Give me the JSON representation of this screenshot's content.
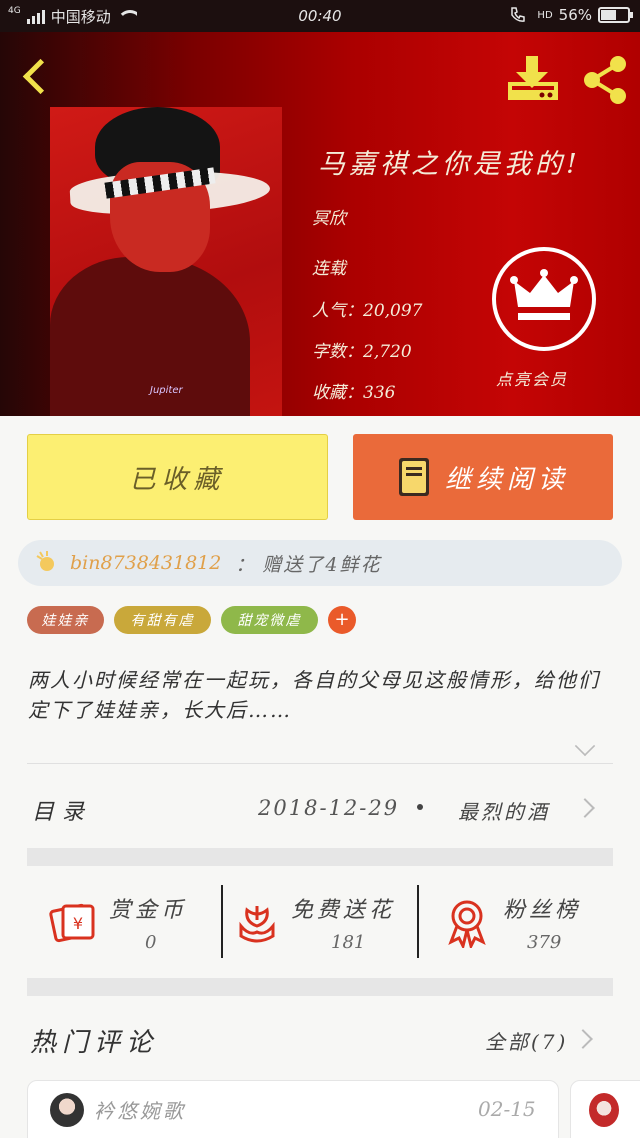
{
  "status_bar": {
    "network": "4G",
    "carrier": "中国移动",
    "time": "00:40",
    "hd": "HD",
    "battery": "56%",
    "battery_level": 0.56
  },
  "header": {
    "title": "马嘉祺之你是我的!",
    "author": "冥欣",
    "status": "连载",
    "popularity": "人气：20,097",
    "word_count": "字数：2,720",
    "favorites": "收藏：336",
    "vip_label": "点亮会员",
    "cover_signature": "Jupiter"
  },
  "actions": {
    "favorited_label": "已收藏",
    "continue_label": "继续阅读"
  },
  "gift": {
    "user": "bin8738431812",
    "separator": "：",
    "text": "赠送了4鲜花"
  },
  "tags": [
    {
      "label": "娃娃亲",
      "color": "#c86b50"
    },
    {
      "label": "有甜有虐",
      "color": "#c9a83a"
    },
    {
      "label": "甜宠微虐",
      "color": "#8fb84a"
    }
  ],
  "tag_add": "+",
  "description": "两人小时候经常在一起玩，各自的父母见这般情形，给他们定下了娃娃亲，长大后……",
  "catalog": {
    "label": "目录",
    "date": "2018-12-29",
    "latest": "最烈的酒"
  },
  "stats": [
    {
      "label": "赏金币",
      "value": "0",
      "icon": "red-envelope-icon"
    },
    {
      "label": "免费送花",
      "value": "181",
      "icon": "flower-icon"
    },
    {
      "label": "粉丝榜",
      "value": "379",
      "icon": "medal-icon"
    }
  ],
  "comments": {
    "label": "热门评论",
    "all_label": "全部(7)",
    "items": [
      {
        "user": "衿悠婉歌",
        "date": "02-15"
      }
    ]
  },
  "colors": {
    "accent_yellow": "#fcef72",
    "accent_orange": "#ea6a3a",
    "header_red": "#b00000",
    "vip_white": "#ffffff"
  }
}
